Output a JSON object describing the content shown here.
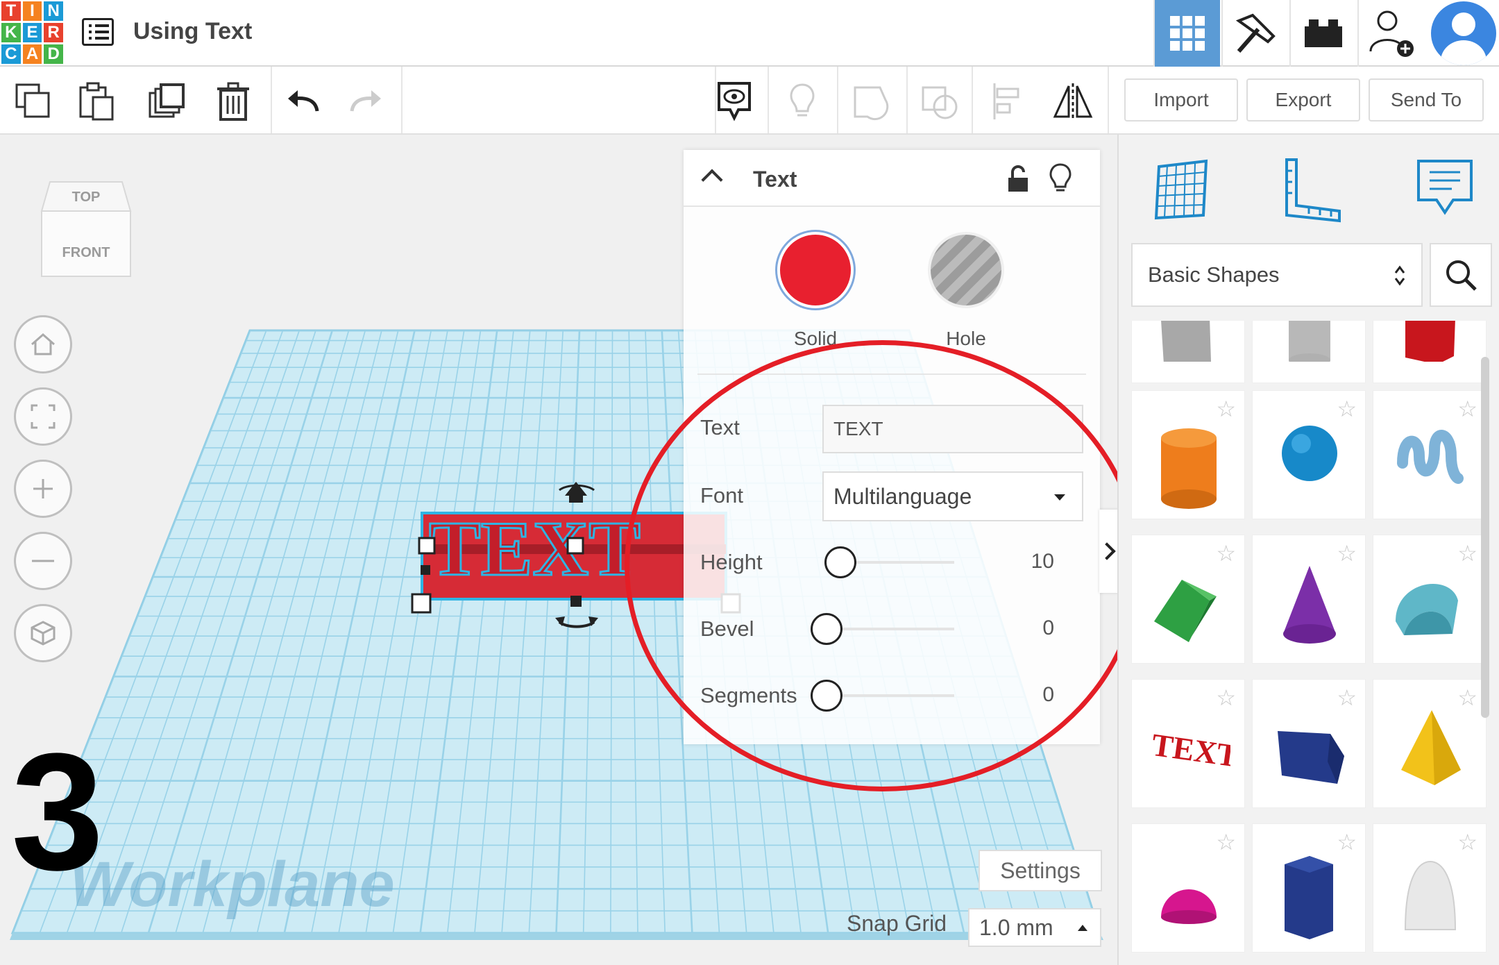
{
  "app": {
    "logo_letters": [
      "T",
      "I",
      "N",
      "K",
      "E",
      "R",
      "C",
      "A",
      "D"
    ],
    "doc_title": "Using Text"
  },
  "toolbar": {
    "import_label": "Import",
    "export_label": "Export",
    "sendto_label": "Send To"
  },
  "viewcube": {
    "top": "TOP",
    "front": "FRONT"
  },
  "workspace": {
    "step_number": "3",
    "workplane_label": "Workplane",
    "settings_label": "Settings",
    "snap_label": "Snap Grid",
    "snap_value": "1.0 mm",
    "shape_text": "TEXT"
  },
  "inspector": {
    "title": "Text",
    "solid_label": "Solid",
    "hole_label": "Hole",
    "text_label": "Text",
    "text_value": "TEXT",
    "font_label": "Font",
    "font_value": "Multilanguage",
    "height_label": "Height",
    "height_value": "10",
    "bevel_label": "Bevel",
    "bevel_value": "0",
    "segments_label": "Segments",
    "segments_value": "0"
  },
  "library": {
    "category": "Basic Shapes"
  },
  "colors": {
    "accent_blue": "#5b9bd5",
    "solid_red": "#e8202f",
    "annotation_red": "#e41e26",
    "grid_blue": "#a8d8ea"
  }
}
